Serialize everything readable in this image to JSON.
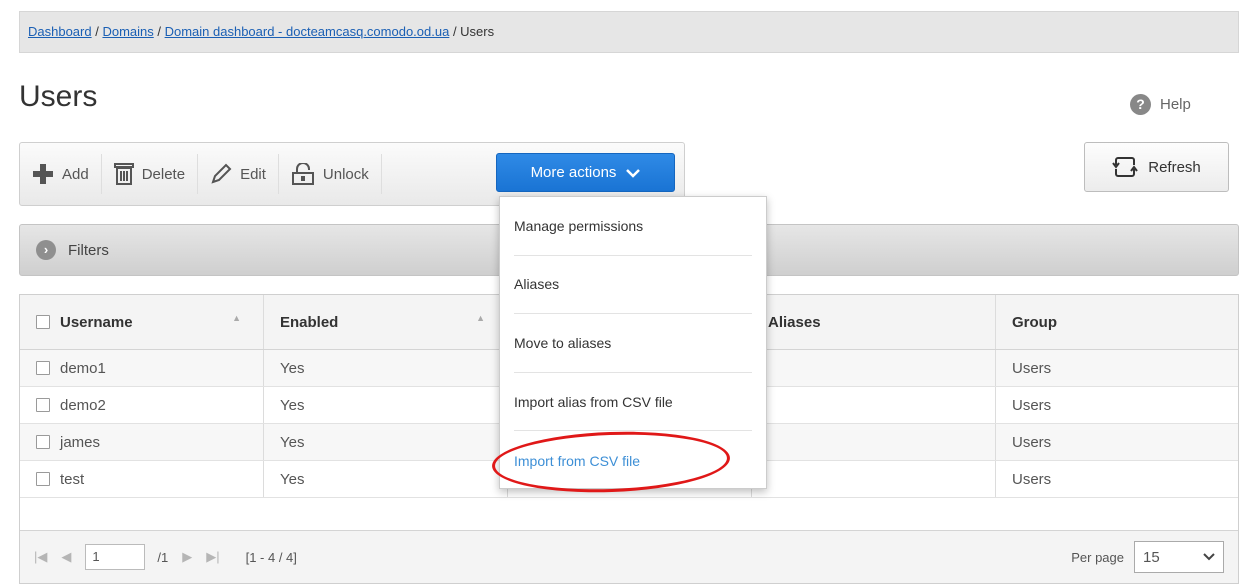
{
  "breadcrumb": {
    "items": [
      "Dashboard",
      "Domains",
      "Domain dashboard - docteamcasq.comodo.od.ua"
    ],
    "current": "Users",
    "separator": " / "
  },
  "page": {
    "title": "Users",
    "help_label": "Help"
  },
  "toolbar": {
    "add": "Add",
    "delete": "Delete",
    "edit": "Edit",
    "unlock": "Unlock",
    "more_actions": "More actions",
    "refresh": "Refresh"
  },
  "filters": {
    "label": "Filters"
  },
  "table": {
    "columns": [
      "Username",
      "Enabled",
      "",
      "Aliases",
      "Group"
    ],
    "rows": [
      {
        "username": "demo1",
        "enabled": "Yes",
        "group": "Users"
      },
      {
        "username": "demo2",
        "enabled": "Yes",
        "group": "Users"
      },
      {
        "username": "james",
        "enabled": "Yes",
        "group": "Users"
      },
      {
        "username": "test",
        "enabled": "Yes",
        "group": "Users"
      }
    ]
  },
  "dropdown": {
    "items": [
      "Manage permissions",
      "Aliases",
      "Move to aliases",
      "Import alias from CSV file",
      "Import from CSV file"
    ]
  },
  "pager": {
    "page": "1",
    "total_pages": "/1",
    "range": "[1 - 4 / 4]",
    "per_page_label": "Per page",
    "per_page": "15"
  },
  "colors": {
    "accent": "#1a74d4",
    "highlight_ring": "#e01818",
    "link": "#3d8fd6"
  }
}
